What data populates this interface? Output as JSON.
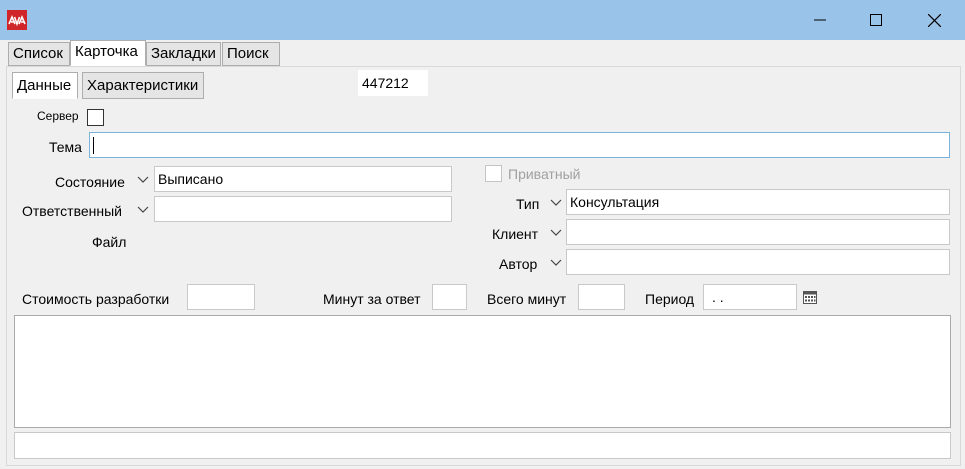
{
  "window": {
    "icon": "ava-logo-icon",
    "controls": [
      "minimize-icon",
      "maximize-icon",
      "close-icon"
    ]
  },
  "tabs": {
    "main": [
      "Список",
      "Карточка",
      "Закладки",
      "Поиск"
    ],
    "active_main": "Карточка",
    "sub": [
      "Данные",
      "Характеристики"
    ],
    "active_sub": "Данные"
  },
  "record_id": "447212",
  "form": {
    "server_label": "Сервер",
    "server_checked": false,
    "topic_label": "Тема",
    "topic_value": "",
    "state_label": "Состояние",
    "state_value": "Выписано",
    "responsible_label": "Ответственный",
    "responsible_value": "",
    "file_label": "Файл",
    "private_label": "Приватный",
    "private_checked": false,
    "type_label": "Тип",
    "type_value": "Консультация",
    "client_label": "Клиент",
    "client_value": "",
    "author_label": "Автор",
    "author_value": "",
    "cost_label": "Стоимость разработки",
    "cost_value": "",
    "minutes_per_answer_label": "Минут за ответ",
    "minutes_per_answer_value": "",
    "total_minutes_label": "Всего минут",
    "total_minutes_value": "",
    "period_label": "Период",
    "period_value": " .  .",
    "notes_value": "",
    "bottom_value": ""
  },
  "colors": {
    "titlebar": "#99c3e9",
    "app_icon": "#d0262a",
    "focus_border": "#7ab3d9"
  }
}
